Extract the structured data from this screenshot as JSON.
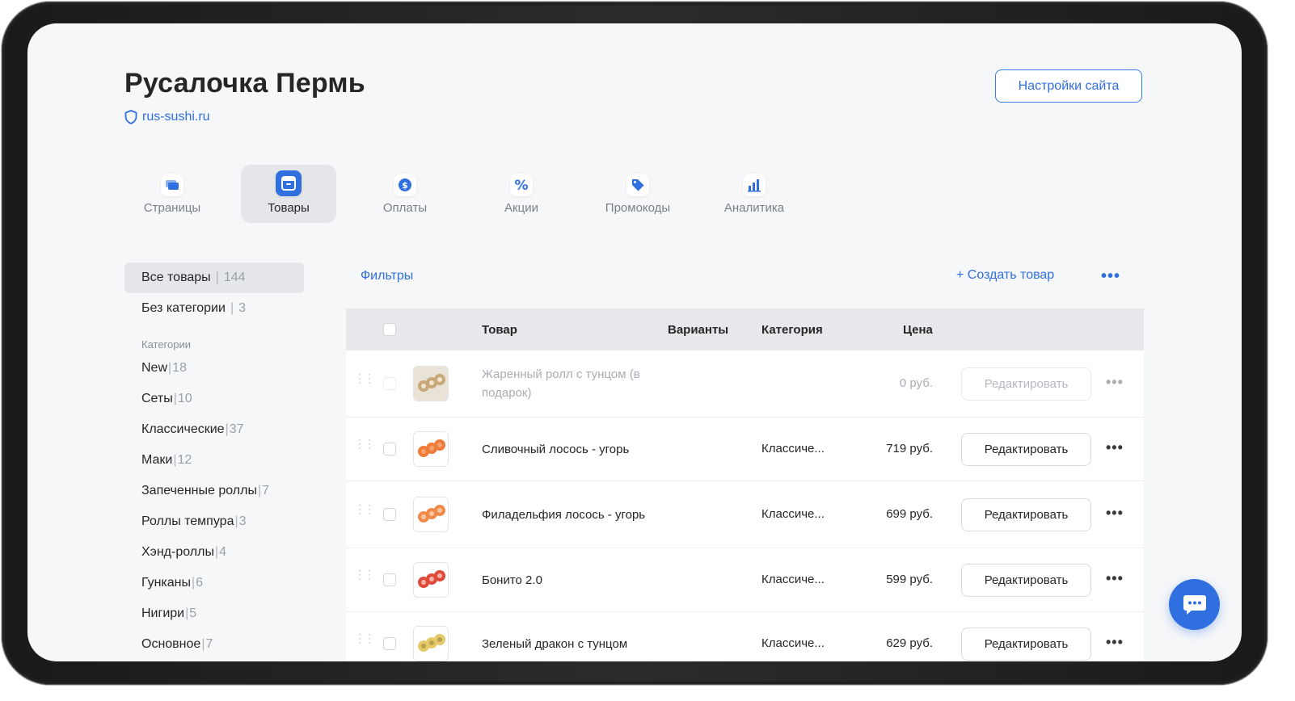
{
  "header": {
    "title": "Русалочка Пермь",
    "domain": "rus-sushi.ru",
    "settings_label": "Настройки сайта"
  },
  "tabs": [
    {
      "label": "Страницы",
      "icon": "pages-icon",
      "active": false
    },
    {
      "label": "Товары",
      "icon": "products-icon",
      "active": true
    },
    {
      "label": "Оплаты",
      "icon": "dollar-icon",
      "active": false
    },
    {
      "label": "Акции",
      "icon": "percent-icon",
      "active": false
    },
    {
      "label": "Промокоды",
      "icon": "tag-icon",
      "active": false
    },
    {
      "label": "Аналитика",
      "icon": "bar-chart-icon",
      "active": false
    }
  ],
  "sidebar": {
    "all": {
      "label": "Все товары",
      "count": "144"
    },
    "uncategorized": {
      "label": "Без категории",
      "count": "3"
    },
    "categories_heading": "Категории",
    "categories": [
      {
        "label": "New",
        "count": "18"
      },
      {
        "label": "Сеты",
        "count": "10"
      },
      {
        "label": "Классические",
        "count": "37"
      },
      {
        "label": "Маки",
        "count": "12"
      },
      {
        "label": "Запеченные роллы",
        "count": "7"
      },
      {
        "label": "Роллы темпура",
        "count": "3"
      },
      {
        "label": "Хэнд-роллы",
        "count": "4"
      },
      {
        "label": "Гунканы",
        "count": "6"
      },
      {
        "label": "Нигири",
        "count": "5"
      },
      {
        "label": "Основное",
        "count": "7"
      }
    ]
  },
  "toolbar": {
    "filters_label": "Фильтры",
    "create_label": "+ Создать товар",
    "more_label": "•••"
  },
  "table": {
    "columns": {
      "product": "Товар",
      "variants": "Варианты",
      "category": "Категория",
      "price": "Цена"
    },
    "edit_label": "Редактировать",
    "more_label": "•••",
    "rows": [
      {
        "name": "Жаренный ролл с тунцом (в подарок)",
        "category": "",
        "price": "0 руб.",
        "dimmed": true
      },
      {
        "name": "Сливочный лосось - угорь",
        "category": "Классиче...",
        "price": "719 руб.",
        "dimmed": false
      },
      {
        "name": "Филадельфия лосось - угорь",
        "category": "Классиче...",
        "price": "699 руб.",
        "dimmed": false
      },
      {
        "name": "Бонито 2.0",
        "category": "Классиче...",
        "price": "599 руб.",
        "dimmed": false
      },
      {
        "name": "Зеленый дракон с тунцом",
        "category": "Классиче...",
        "price": "629 руб.",
        "dimmed": false
      }
    ]
  },
  "colors": {
    "accent": "#2f6fe0",
    "background": "#f6f7f9",
    "header_row": "#e6e8eb"
  }
}
